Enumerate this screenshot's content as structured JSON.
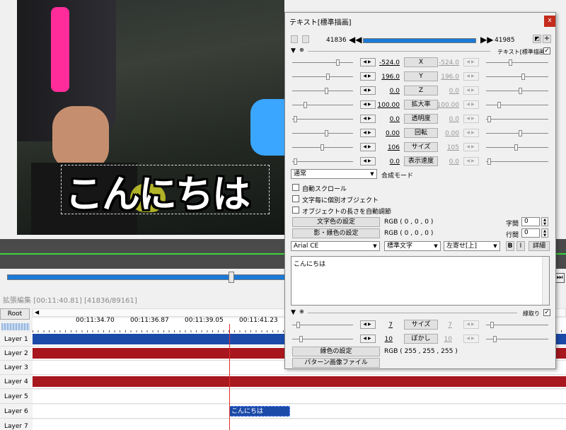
{
  "preview": {
    "caption": "こんにちは"
  },
  "timeline": {
    "title": "拡張編集 [00:11:40.81] [41836/89161]",
    "root_label": "Root",
    "ticks": [
      "00:11:34.70",
      "00:11:36.87",
      "00:11:39.05",
      "00:11:41.23"
    ],
    "layers": [
      "Layer 1",
      "Layer 2",
      "Layer 3",
      "Layer 4",
      "Layer 5",
      "Layer 6",
      "Layer 7"
    ],
    "text_clip": "こんにちは",
    "colors": {
      "layer1": "#1b4aa8",
      "layer2": "#a8161e",
      "layer4": "#a8161e"
    }
  },
  "dialog": {
    "title": "テキスト[標準描画]",
    "close": "x",
    "frame_start": "41836",
    "frame_end": "41985",
    "obj_label": "テキスト[標準描画]",
    "params": [
      {
        "name": "X",
        "left": "-524.0",
        "right": "-524.0"
      },
      {
        "name": "Y",
        "left": "196.0",
        "right": "196.0"
      },
      {
        "name": "Z",
        "left": "0.0",
        "right": "0.0"
      },
      {
        "name": "拡大率",
        "left": "100.00",
        "right": "100.00"
      },
      {
        "name": "透明度",
        "left": "0.0",
        "right": "0.0"
      },
      {
        "name": "回転",
        "left": "0.00",
        "right": "0.00"
      },
      {
        "name": "サイズ",
        "left": "106",
        "right": "105"
      },
      {
        "name": "表示速度",
        "left": "0.0",
        "right": "0.0"
      }
    ],
    "blend_mode": "通常",
    "blend_label": "合成モード",
    "checks": [
      "自動スクロール",
      "文字毎に個別オブジェクト",
      "オブジェクトの長さを自動調節"
    ],
    "text_color_btn": "文字色の設定",
    "text_color_val": "RGB ( 0 , 0 , 0 )",
    "shadow_color_btn": "影・縁色の設定",
    "shadow_color_val": "RGB ( 0 , 0 , 0 )",
    "char_spacing_label": "字間",
    "char_spacing": "0",
    "line_spacing_label": "行間",
    "line_spacing": "0",
    "font": "Arial CE",
    "style": "標準文字",
    "align": "左寄せ[上]",
    "bold": "B",
    "italic": "I",
    "detail": "詳細",
    "text_content": "こんにちは",
    "filter_label": "縁取り",
    "filter_params": [
      {
        "name": "サイズ",
        "left": "7",
        "right": "7"
      },
      {
        "name": "ぼかし",
        "left": "10",
        "right": "10"
      }
    ],
    "edge_color_btn": "縁色の設定",
    "edge_color_val": "RGB ( 255 , 255 , 255 )",
    "pattern_btn": "パターン画像ファイル"
  }
}
